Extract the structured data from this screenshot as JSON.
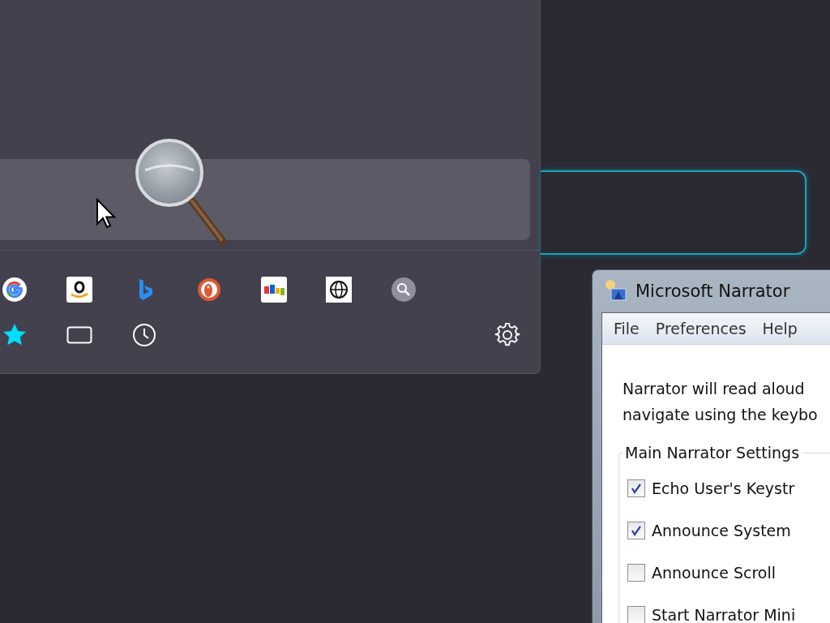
{
  "search_panel": {
    "engines": [
      {
        "kind": "google"
      },
      {
        "kind": "amazon"
      },
      {
        "kind": "bing"
      },
      {
        "kind": "duckduckgo"
      },
      {
        "kind": "ebay"
      },
      {
        "kind": "wikipedia"
      },
      {
        "kind": "search"
      }
    ],
    "modes": [
      {
        "kind": "bookmarks"
      },
      {
        "kind": "tabs"
      },
      {
        "kind": "history"
      }
    ]
  },
  "narrator": {
    "title": "Microsoft Narrator",
    "menu": [
      "File",
      "Preferences",
      "Help"
    ],
    "description": [
      "Narrator will read aloud",
      "navigate using the keybo"
    ],
    "group_title": "Main Narrator Settings",
    "options": [
      {
        "label": "Echo User's Keystr",
        "checked": true
      },
      {
        "label": "Announce System",
        "checked": true
      },
      {
        "label": "Announce Scroll",
        "checked": false
      },
      {
        "label": "Start Narrator Mini",
        "checked": false
      }
    ]
  }
}
